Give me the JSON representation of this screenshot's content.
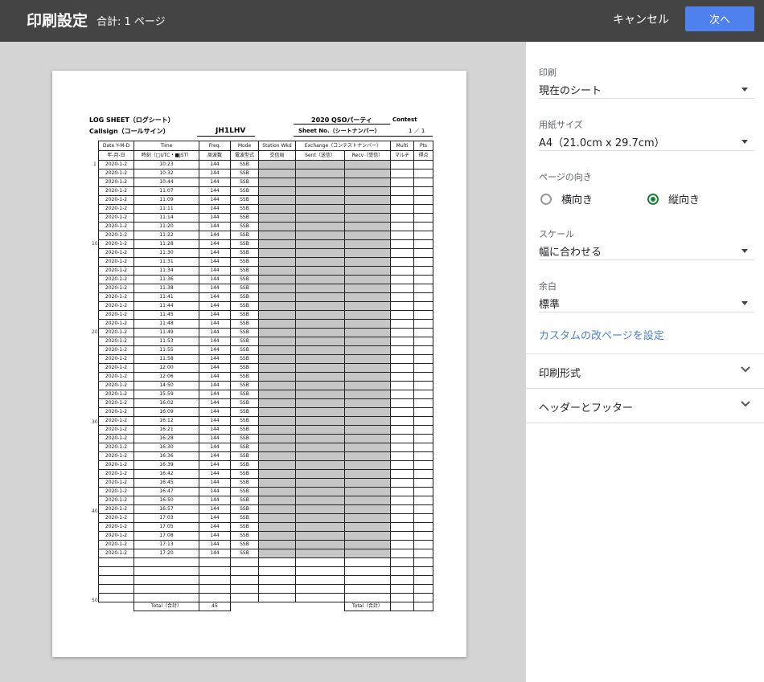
{
  "header": {
    "title": "印刷設定",
    "page_count": "合計: 1 ページ",
    "cancel_label": "キャンセル",
    "next_label": "次へ"
  },
  "sheet": {
    "title_left": "LOG SHEET（ログシート）",
    "callsign_label": "Callsign（コールサイン）",
    "callsign_value": "JH1LHV",
    "event_name": "2020 QSOパーティ",
    "contest_label": "Contest",
    "sheet_no_label": "Sheet No.（シートナンバー）",
    "sheet_no_value": "1 ／ 1",
    "columns": {
      "date": "Date Y-M-D",
      "date_sub": "年-月-日",
      "time": "Time",
      "time_sub": "時刻（□UTC・■JST）",
      "freq": "Freq.",
      "freq_sub": "周波数",
      "mode": "Mode",
      "mode_sub": "電波型式",
      "station": "Station Wkd",
      "station_sub": "交信局",
      "exchange": "Exchange（コンテストナンバー）",
      "sent": "Sent（送信）",
      "recv": "Recv（受信）",
      "multi": "Multi",
      "multi_sub": "マルチ",
      "pts": "Pts",
      "pts_sub": "得点"
    },
    "row_markers": [
      "1",
      "10",
      "20",
      "30",
      "40",
      "50"
    ],
    "date_value": "2020-1-2",
    "freq_value": "144",
    "mode_value": "SSB",
    "times": [
      "10:23",
      "10:32",
      "10:44",
      "11:07",
      "11:09",
      "11:11",
      "11:14",
      "11:20",
      "11:22",
      "11:28",
      "11:30",
      "11:31",
      "11:34",
      "11:36",
      "11:38",
      "11:41",
      "11:44",
      "11:45",
      "11:48",
      "11:49",
      "11:53",
      "11:55",
      "11:58",
      "12:00",
      "12:06",
      "14:50",
      "15:59",
      "16:02",
      "16:09",
      "16:12",
      "16:21",
      "16:28",
      "16:30",
      "16:36",
      "16:39",
      "16:42",
      "16:45",
      "16:47",
      "16:50",
      "16:57",
      "17:03",
      "17:05",
      "17:08",
      "17:13",
      "17:20"
    ],
    "empty_rows": 5,
    "total_label": "Total（合計）",
    "total_freq": "45",
    "total_label_right": "Total（合計）"
  },
  "settings": {
    "print_label": "印刷",
    "print_value": "現在のシート",
    "paper_label": "用紙サイズ",
    "paper_value": "A4（21.0cm x 29.7cm）",
    "orientation_label": "ページの向き",
    "landscape_label": "横向き",
    "portrait_label": "縦向き",
    "scale_label": "スケール",
    "scale_value": "幅に合わせる",
    "margin_label": "余白",
    "margin_value": "標準",
    "custom_break_link": "カスタムの改ページを設定",
    "format_label": "印刷形式",
    "header_footer_label": "ヘッダーとフッター"
  },
  "colors": {
    "topbar": "#444444",
    "primary_button": "#4e80ee",
    "radio_selected": "#188038",
    "link": "#4a7fd8"
  }
}
